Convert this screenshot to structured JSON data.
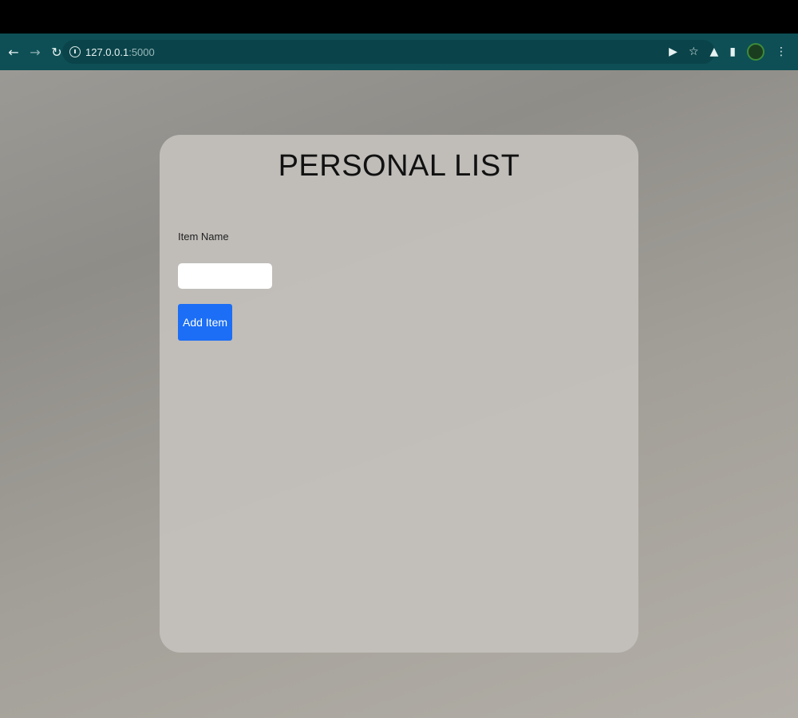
{
  "browser": {
    "url_host": "127.0.0.1",
    "url_port": ":5000",
    "icons": [
      "back-arrow-icon",
      "forward-arrow-icon",
      "reload-icon",
      "info-icon",
      "cast-icon",
      "star-icon",
      "extensions-icon",
      "tab-icon",
      "profile-avatar",
      "more-icon"
    ]
  },
  "card": {
    "title": "PERSONAL LIST",
    "item_label": "Item Name",
    "item_value": "",
    "add_button": "Add Item"
  },
  "colors": {
    "browser_bar": "#0d4f55",
    "button": "#1b6ef5"
  }
}
